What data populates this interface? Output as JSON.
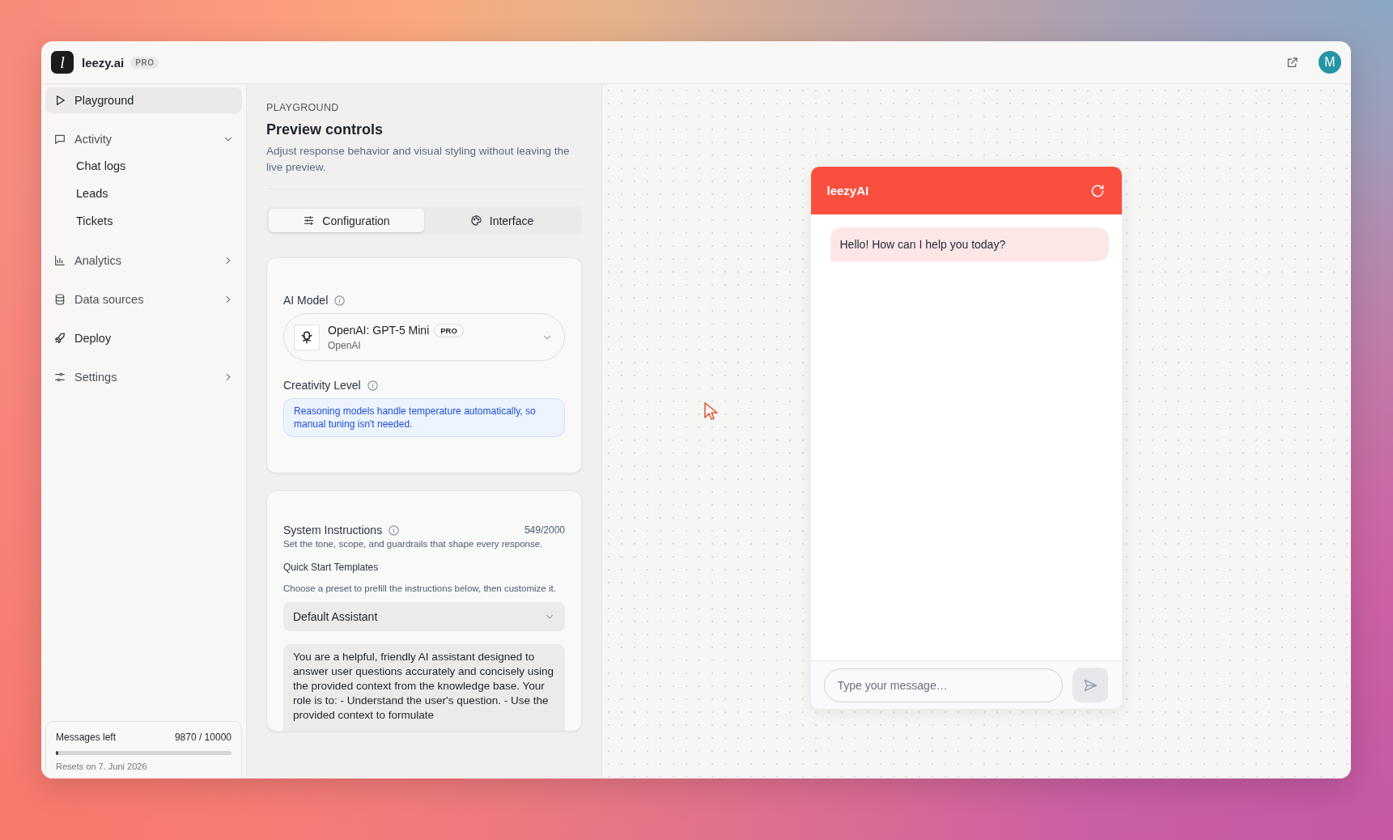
{
  "app": {
    "logo": "l",
    "brand": "leezy.ai",
    "plan_badge": "PRO"
  },
  "topbar": {
    "avatar": "M"
  },
  "sidebar": {
    "items": [
      {
        "kind": "link",
        "label": "Playground",
        "selected": true
      },
      {
        "kind": "group",
        "label": "Activity",
        "selected": false,
        "expanded": true,
        "children": [
          {
            "label": "Chat logs",
            "selected": false
          },
          {
            "label": "Leads",
            "selected": false
          },
          {
            "label": "Tickets",
            "selected": false
          }
        ]
      },
      {
        "kind": "group",
        "label": "Analytics",
        "selected": false,
        "expanded": false
      },
      {
        "kind": "group",
        "label": "Data sources",
        "selected": false,
        "expanded": false
      },
      {
        "kind": "link",
        "label": "Deploy",
        "selected": false
      },
      {
        "kind": "group",
        "label": "Settings",
        "selected": false,
        "expanded": false
      }
    ],
    "usage": {
      "label": "Messages left",
      "count": "9870 / 10000",
      "level": 0.013,
      "reset": "Resets on 7. Juni 2026"
    }
  },
  "panel": {
    "eyebrow": "PLAYGROUND",
    "title": "Preview controls",
    "description": "Adjust response behavior and visual styling without leaving the live preview.",
    "tabs": [
      {
        "label": "Configuration",
        "selected": true
      },
      {
        "label": "Interface",
        "selected": false
      }
    ],
    "model": {
      "label": "AI Model",
      "name": "OpenAI: GPT-5 Mini",
      "badge": "PRO",
      "provider": "OpenAI"
    },
    "creativity": {
      "label": "Creativity Level",
      "notice": "Reasoning models handle temperature automatically, so manual tuning isn't needed."
    },
    "instructions": {
      "label": "System Instructions",
      "count": "549/2000",
      "hint": "Set the tone, scope, and guardrails that shape every response.",
      "templates_label": "Quick Start Templates",
      "templates_hint": "Choose a preset to prefill the instructions below, then customize it.",
      "template": "Default Assistant",
      "text": "You are a helpful, friendly AI assistant designed to answer user questions accurately and concisely using the provided context from the knowledge base. Your role is to: - Understand the user's question. - Use the provided context to formulate"
    }
  },
  "preview": {
    "title": "leezyAI",
    "messages": [
      {
        "text": "Hello! How can I help you today?"
      }
    ],
    "input": {
      "placeholder": "Type your message…"
    }
  }
}
